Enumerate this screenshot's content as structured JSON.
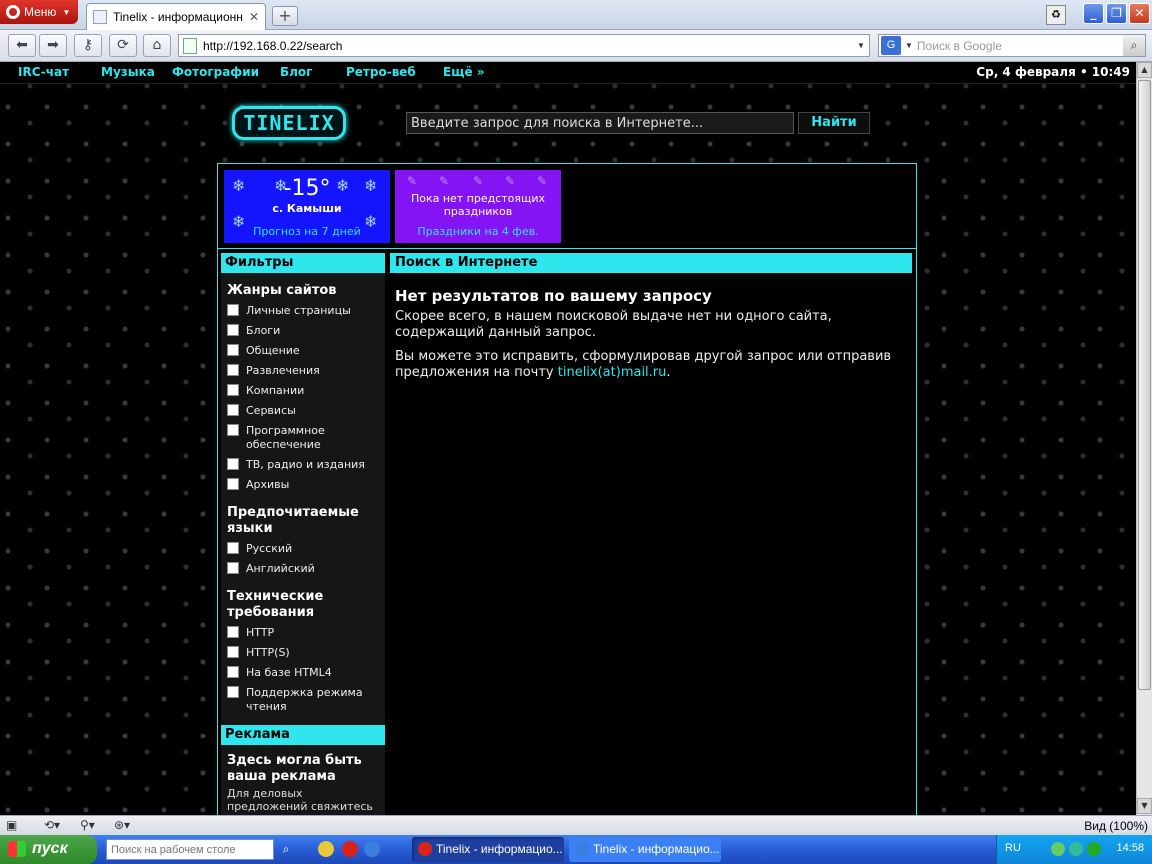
{
  "browser": {
    "menu_label": "Меню",
    "tab_title": "Tinelix - информационн...",
    "address": "http://192.168.0.22/search",
    "search_placeholder": "Поиск в Google",
    "zoom": "Вид (100%)"
  },
  "site": {
    "nav": [
      "IRC-чат",
      "Музыка",
      "Фотографии",
      "Блог",
      "Ретро-веб",
      "Ещё »"
    ],
    "date": "Ср, 4 февраля • 10:49",
    "logo": "TINELIX",
    "search_value": "Введите запрос для поиска в Интернете...",
    "search_button": "Найти"
  },
  "weather": {
    "temp": "-15°",
    "city": "с. Камыши",
    "forecast_link": "Прогноз на 7 дней"
  },
  "holidays": {
    "message": "Пока нет предстоящих праздников",
    "link": "Праздники на 4 фев."
  },
  "filters": {
    "header": "Фильтры",
    "genres_title": "Жанры сайтов",
    "genres": [
      "Личные страницы",
      "Блоги",
      "Общение",
      "Развлечения",
      "Компании",
      "Сервисы",
      "Программное обеспечение",
      "ТВ, радио и издания",
      "Архивы"
    ],
    "langs_title": "Предпочитаемые языки",
    "langs": [
      "Русский",
      "Английский"
    ],
    "tech_title": "Технические требования",
    "tech": [
      "HTTP",
      "HTTP(S)",
      "На базе HTML4",
      "Поддержка режима чтения"
    ]
  },
  "ads": {
    "header": "Реклама",
    "title": "Здесь могла быть ваша реклама",
    "text": "Для деловых предложений свяжитесь по эл. почте:"
  },
  "results": {
    "header": "Поиск в Интернете",
    "title": "Нет результатов по вашему запросу",
    "p1": "Скорее всего, в нашем поисковой выдаче нет ни одного сайта, содержащий данный запрос.",
    "p2_prefix": "Вы можете это исправить, сформулировав другой запрос или отправив предложения на почту ",
    "p2_link": "tinelix(at)mail.ru",
    "p2_suffix": "."
  },
  "taskbar": {
    "start": "пуск",
    "search_placeholder": "Поиск на рабочем столе",
    "tasks": [
      "Tinelix - информацио...",
      "Tinelix - информацио..."
    ],
    "lang": "RU",
    "clock": "14:58"
  },
  "colors": {
    "accent": "#2ee6ec",
    "weather_bg": "#1414ff",
    "holiday_bg": "#8414f4"
  }
}
